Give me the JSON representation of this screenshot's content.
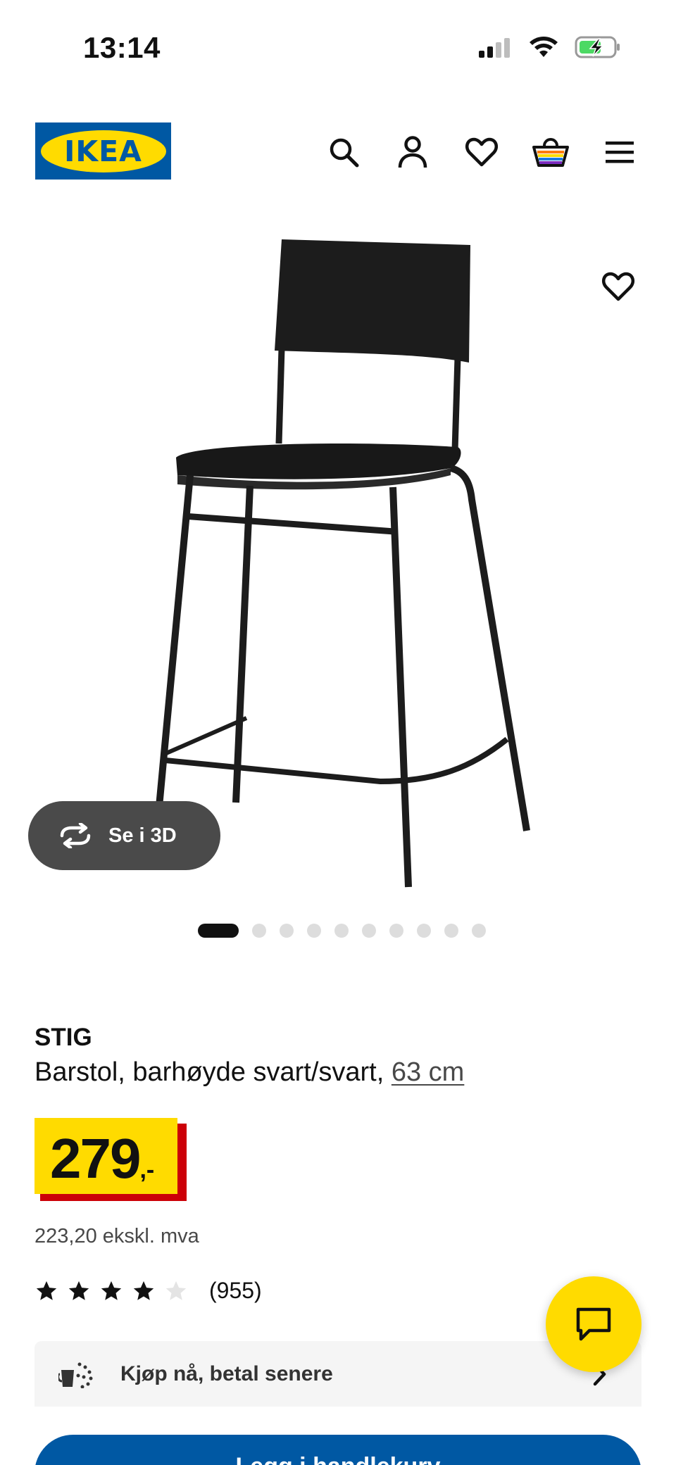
{
  "status_bar": {
    "time": "13:14"
  },
  "header": {
    "logo_text": "IKEA"
  },
  "media": {
    "view_3d_label": "Se i 3D",
    "slide_count": 10,
    "active_slide": 1
  },
  "product": {
    "name": "STIG",
    "description": "Barstol, barhøyde svart/svart, ",
    "size_link": "63 cm",
    "price_integer": "279",
    "price_decimal": ",-",
    "price_excl_vat": "223,20 ekskl. mva",
    "rating_stars": 4,
    "rating_max": 5,
    "rating_count": "(955)"
  },
  "payment": {
    "klarna_label": "Kjøp nå, betal senere"
  },
  "actions": {
    "buy_label": "Legg i handlekurv"
  },
  "colors": {
    "ikea_blue": "#0058a3",
    "ikea_yellow": "#ffdb00",
    "price_red": "#cc0008",
    "battery_green": "#4cd964"
  }
}
